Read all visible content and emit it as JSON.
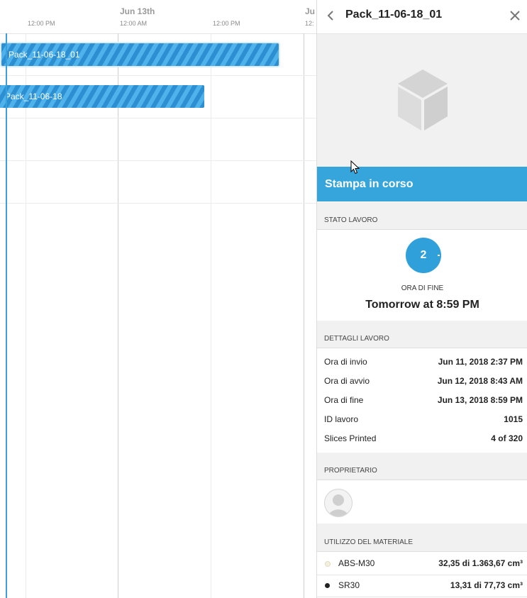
{
  "timeline": {
    "days": [
      "Jun 13th",
      "Ju"
    ],
    "hours": [
      "12:00 PM",
      "12:00 AM",
      "12:00 PM",
      "12:"
    ],
    "jobs": [
      {
        "label": "Pack_11-06-18_01"
      },
      {
        "label": "Pack_11-06-18"
      }
    ]
  },
  "panel": {
    "title": "Pack_11-06-18_01",
    "status": "Stampa in corso",
    "job_status": {
      "header": "STATO LAVORO",
      "progress_value": "2",
      "end_label": "ORA DI FINE",
      "end_value": "Tomorrow at 8:59 PM"
    },
    "job_details": {
      "header": "DETTAGLI LAVORO",
      "rows": [
        {
          "label": "Ora di invio",
          "value": "Jun 11, 2018 2:37 PM"
        },
        {
          "label": "Ora di avvio",
          "value": "Jun 12, 2018 8:43 AM"
        },
        {
          "label": "Ora di fine",
          "value": "Jun 13, 2018 8:59 PM"
        },
        {
          "label": "ID lavoro",
          "value": "1015"
        },
        {
          "label": "Slices Printed",
          "value": "4 of 320"
        }
      ]
    },
    "owner": {
      "header": "PROPRIETARIO"
    },
    "materials": {
      "header": "UTILIZZO DEL MATERIALE",
      "rows": [
        {
          "name": "ABS-M30",
          "amount": "32,35 di 1.363,67 cm³",
          "color": "#f4f0de"
        },
        {
          "name": "SR30",
          "amount": "13,31 di 77,73 cm³",
          "color": "#222222"
        }
      ]
    }
  },
  "colors": {
    "accent": "#35a5dc",
    "bar": "#2b8fd1"
  },
  "icons": [
    "chevron-left-icon",
    "close-icon",
    "box-placeholder-icon",
    "avatar-placeholder-icon",
    "mouse-cursor-icon"
  ]
}
